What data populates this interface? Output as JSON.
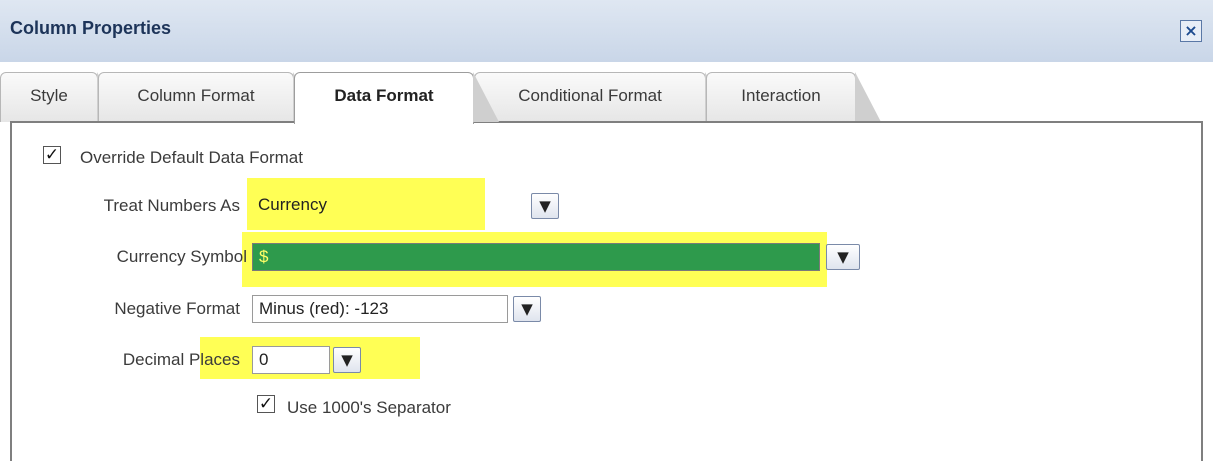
{
  "dialog": {
    "title": "Column Properties",
    "close_icon": "×"
  },
  "tabs": [
    {
      "label": "Style"
    },
    {
      "label": "Column Format"
    },
    {
      "label": "Data Format"
    },
    {
      "label": "Conditional Format"
    },
    {
      "label": "Interaction"
    }
  ],
  "active_tab": "Data Format",
  "override": {
    "checked": true,
    "label": "Override Default Data Format"
  },
  "treat_numbers": {
    "label": "Treat Numbers As",
    "value": "Currency"
  },
  "currency_symbol": {
    "label": "Currency Symbol",
    "value": "$"
  },
  "negative_format": {
    "label": "Negative Format",
    "value": "Minus (red): -123"
  },
  "decimal_places": {
    "label": "Decimal Places",
    "value": "0"
  },
  "separator": {
    "checked": true,
    "label": "Use 1000's Separator"
  },
  "colors": {
    "highlight": "#ffff55",
    "selected_bg": "#2e9a4c",
    "title_text": "#1d3459"
  }
}
